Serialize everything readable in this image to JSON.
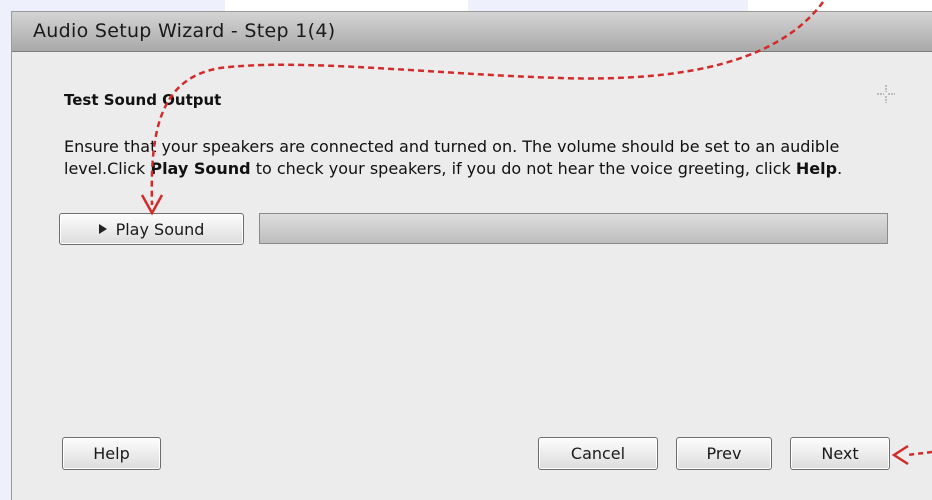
{
  "window": {
    "title": "Audio Setup Wizard - Step 1(4)"
  },
  "content": {
    "section_title": "Test Sound Output",
    "description_part1": "Ensure that your speakers are connected and turned on. The volume should be set to an audible level.Click ",
    "description_bold1": "Play Sound",
    "description_part2": " to check your speakers, if you do not hear the voice greeting, click ",
    "description_bold2": "Help",
    "description_part3": "."
  },
  "controls": {
    "play_sound_label": "Play Sound",
    "progress_fraction": 0
  },
  "footer": {
    "help_label": "Help",
    "cancel_label": "Cancel",
    "prev_label": "Prev",
    "next_label": "Next"
  },
  "colors": {
    "annotation_arrow": "#d42a2a",
    "background_accent": "#eef0fb"
  }
}
